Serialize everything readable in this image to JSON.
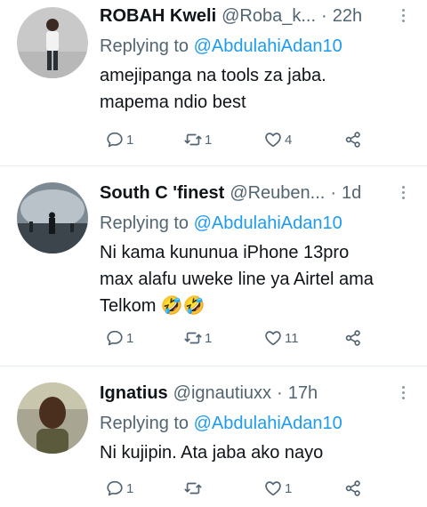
{
  "tweets": [
    {
      "name": "ROBAH Kweli",
      "handle": "@Roba_k...",
      "time": "22h",
      "replying_label": "Replying to",
      "replying_to": "@AbdulahiAdan10",
      "lines": [
        "amejipanga na tools za jaba.",
        "mapema ndio best"
      ],
      "replies": "1",
      "retweets": "1",
      "likes": "4",
      "avatar_bg": "#c8c8c8"
    },
    {
      "name": "South C 'finest",
      "handle": "@Reuben...",
      "time": "1d",
      "replying_label": "Replying to",
      "replying_to": "@AbdulahiAdan10",
      "lines": [
        "Ni kama kununua iPhone 13pro",
        "max alafu uweke line ya Airtel ama",
        "Telkom 🤣🤣"
      ],
      "replies": "1",
      "retweets": "1",
      "likes": "11",
      "avatar_bg": "#5d6770"
    },
    {
      "name": "Ignatius",
      "handle": "@ignautiuxx",
      "time": "17h",
      "replying_label": "Replying to",
      "replying_to": "@AbdulahiAdan10",
      "lines": [
        "Ni kujipin. Ata jaba ako nayo"
      ],
      "replies": "1",
      "retweets": "",
      "likes": "1",
      "avatar_bg": "#8b8b7a"
    }
  ],
  "icons": [
    "reply-icon",
    "retweet-icon",
    "like-icon",
    "share-icon",
    "more-icon"
  ],
  "colors": {
    "link": "#1d9bf0",
    "secondary": "#536471",
    "divider": "#e6ecf0"
  }
}
